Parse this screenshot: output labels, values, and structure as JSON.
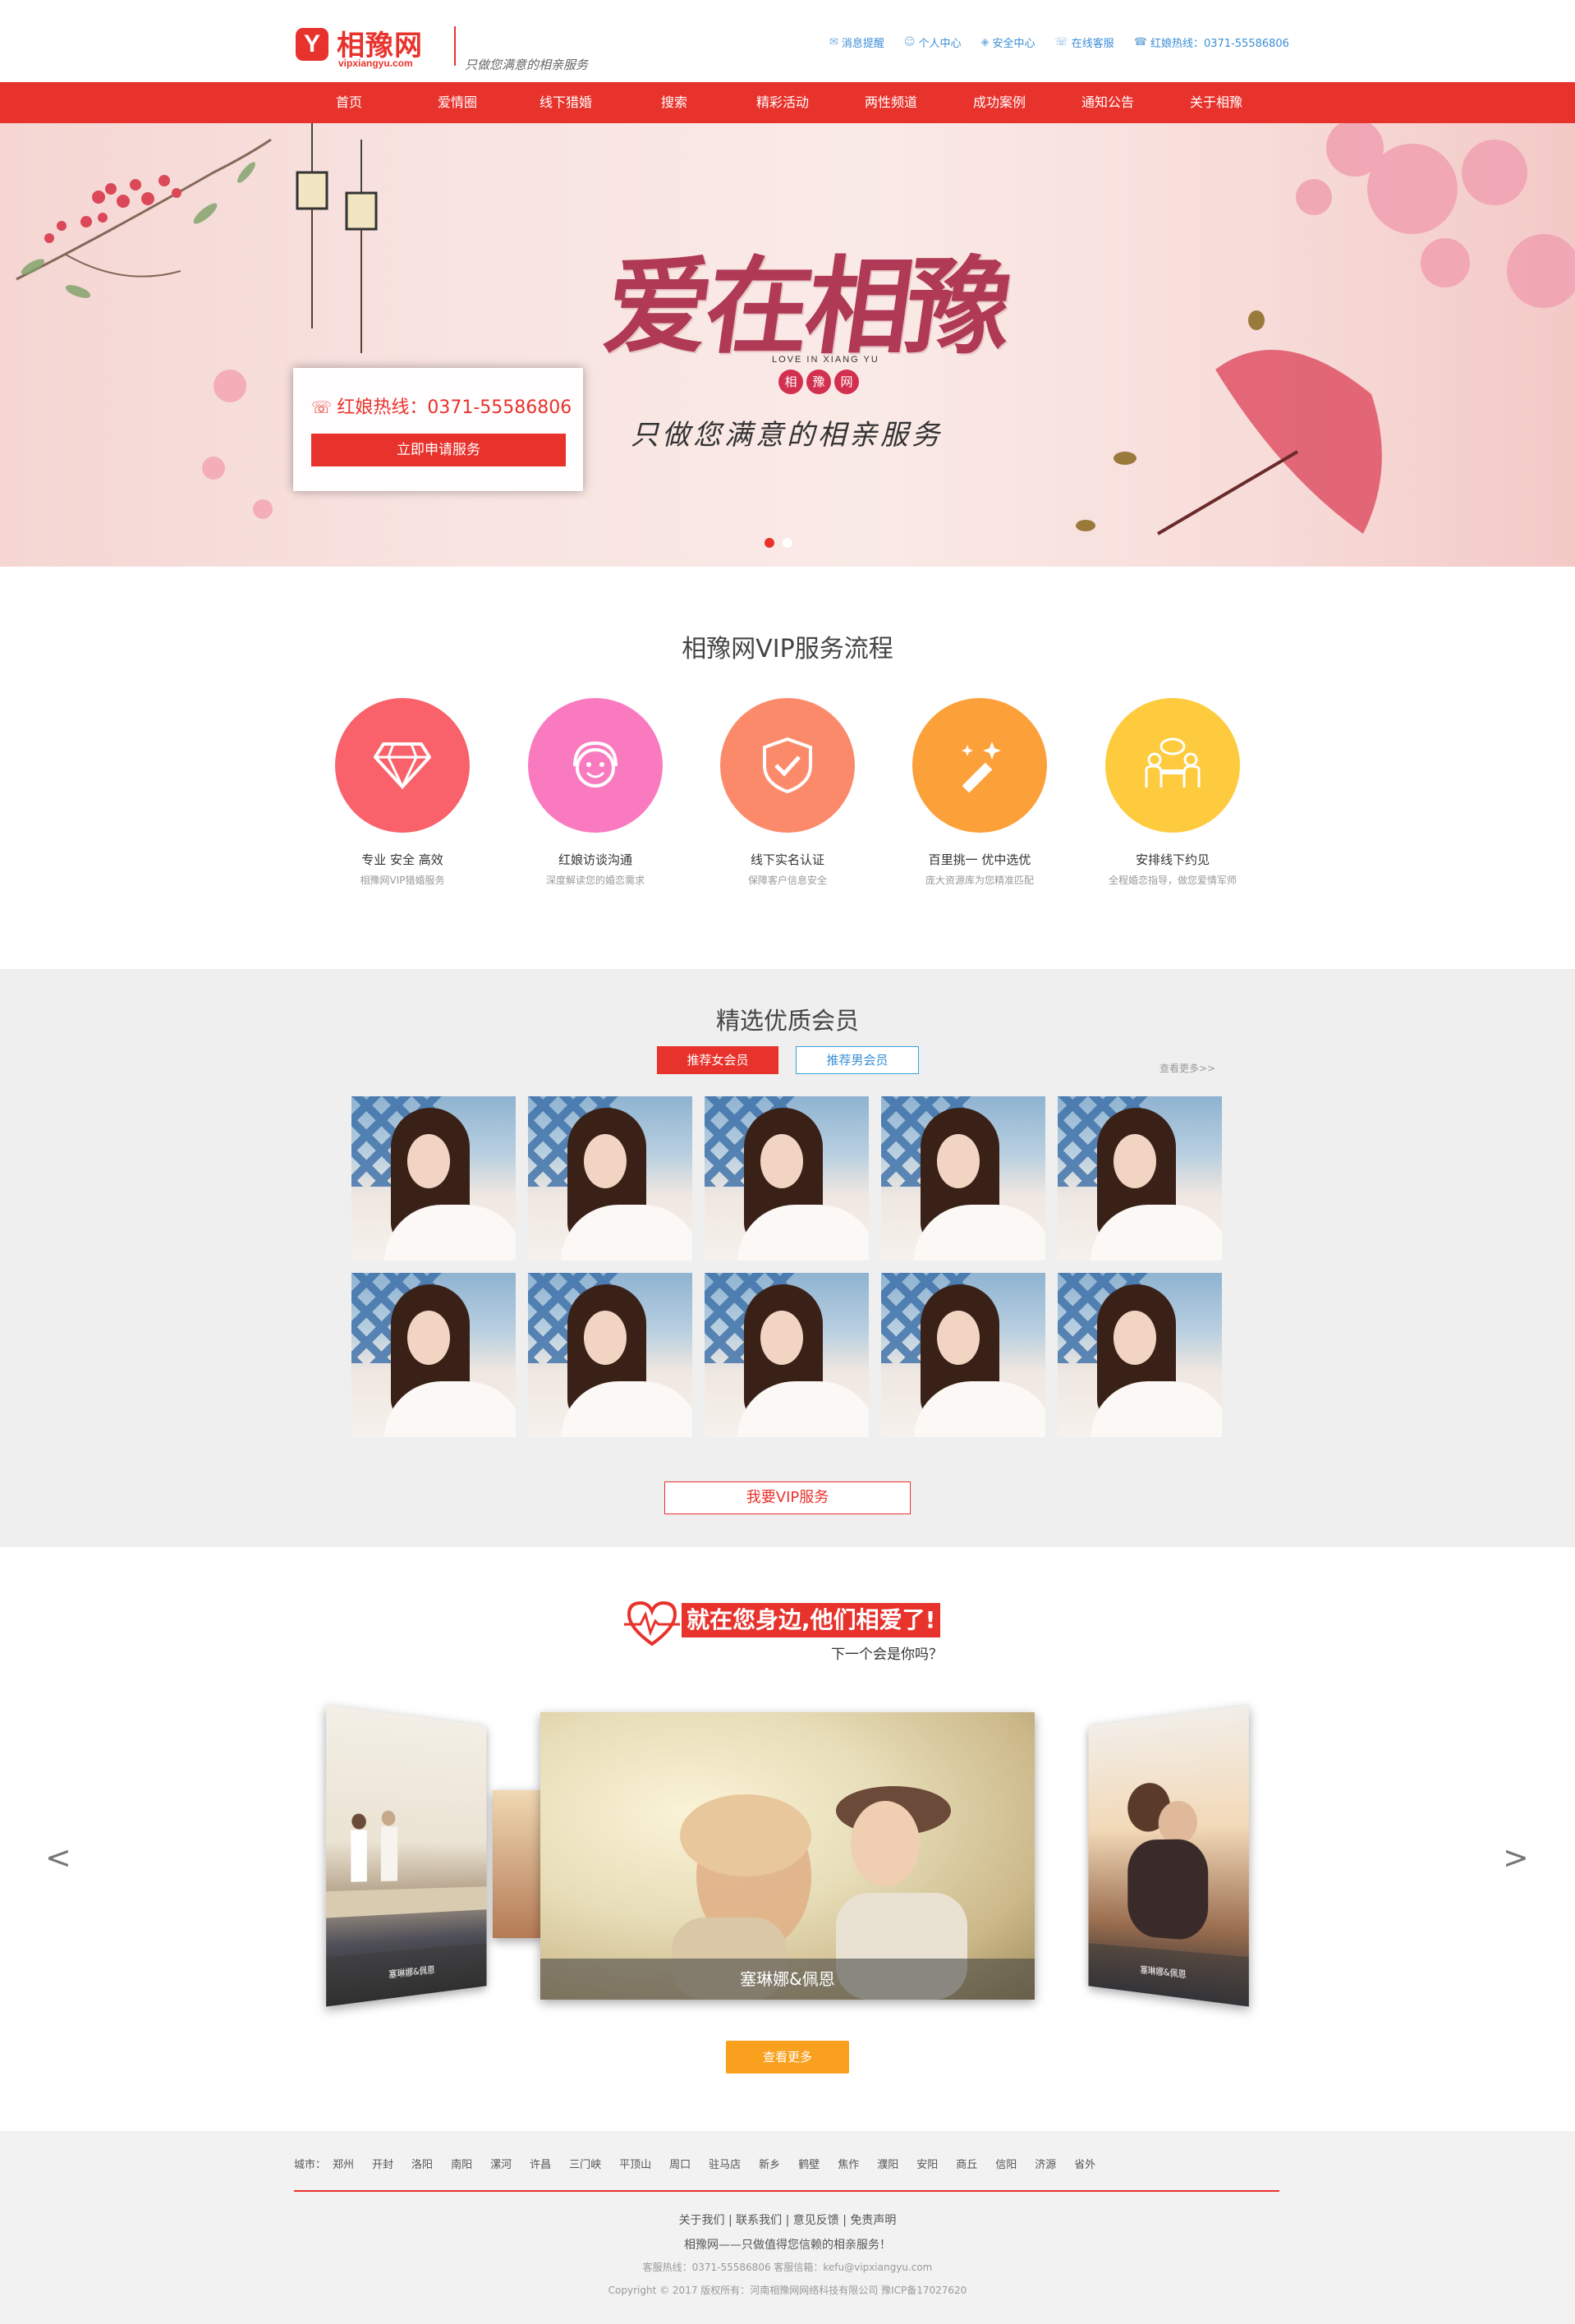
{
  "header": {
    "logo_glyph": "Y",
    "logo_name": "相豫网",
    "logo_domain": "vipxiangyu.com",
    "slogan": "只做您满意的相亲服务",
    "top_links": [
      {
        "icon": "message-icon",
        "label": "消息提醒"
      },
      {
        "icon": "user-icon",
        "label": "个人中心"
      },
      {
        "icon": "shield-icon",
        "label": "安全中心"
      },
      {
        "icon": "chat-icon",
        "label": "在线客服"
      },
      {
        "icon": "phone-icon",
        "label": "红娘热线：0371-55586806"
      }
    ]
  },
  "nav": {
    "items": [
      "首页",
      "爱情圈",
      "线下猎婚",
      "搜索",
      "精彩活动",
      "两性频道",
      "成功案例",
      "通知公告",
      "关于相豫"
    ]
  },
  "banner": {
    "title": "爱在相豫",
    "subtitle_en": "LOVE IN   XIANG  YU",
    "brand_chars": [
      "相",
      "豫",
      "网"
    ],
    "slogan": "只做您满意的相亲服务",
    "hotline": "红娘热线：0371-55586806",
    "apply_button": "立即申请服务",
    "slide_count": 2,
    "active_slide": 1
  },
  "process": {
    "title": "相豫网VIP服务流程",
    "steps": [
      {
        "icon": "diamond-icon",
        "color": "#f9616b",
        "title": "专业 安全 高效",
        "desc": "相豫网VIP猎婚服务"
      },
      {
        "icon": "headset-icon",
        "color": "#fa7ac0",
        "title": "红娘访谈沟通",
        "desc": "深度解读您的婚恋需求"
      },
      {
        "icon": "shield-check-icon",
        "color": "#fb8a6b",
        "title": "线下实名认证",
        "desc": "保障客户信息安全"
      },
      {
        "icon": "magic-wand-icon",
        "color": "#fca03a",
        "title": "百里挑一 优中选优",
        "desc": "庞大资源库为您精准匹配"
      },
      {
        "icon": "meeting-icon",
        "color": "#fecb3e",
        "title": "安排线下约见",
        "desc": "全程婚恋指导，做您爱情军师"
      }
    ]
  },
  "members": {
    "title": "精选优质会员",
    "tab_female": "推荐女会员",
    "tab_male": "推荐男会员",
    "more": "查看更多>>",
    "photo_count": 10,
    "vip_button": "我要VIP服务"
  },
  "love": {
    "title": "就在您身边,他们相爱了!",
    "subtitle": "下一个会是你吗？",
    "center_caption": "塞琳娜&佩恩",
    "side_captions": [
      "塞琳娜&佩恩",
      "塞琳娜&佩恩"
    ],
    "prev": "<",
    "next": ">",
    "more_button": "查看更多"
  },
  "footer": {
    "city_label": "城市：",
    "cities": [
      "郑州",
      "开封",
      "洛阳",
      "南阳",
      "漯河",
      "许昌",
      "三门峡",
      "平顶山",
      "周口",
      "驻马店",
      "新乡",
      "鹤壁",
      "焦作",
      "濮阳",
      "安阳",
      "商丘",
      "信阳",
      "济源",
      "省外"
    ],
    "links": "关于我们 | 联系我们 | 意见反馈 | 免责声明",
    "tagline": "相豫网——只做值得您信赖的相亲服务！",
    "contact": "客服热线：0371-55586806     客服信箱：kefu@vipxiangyu.com",
    "copyright": "Copyright © 2017 版权所有：河南相豫网网络科技有限公司 豫ICP备17027620"
  },
  "colors": {
    "brand_red": "#e8322c",
    "link_blue": "#3a8ed6",
    "orange_button": "#f9a11e"
  }
}
